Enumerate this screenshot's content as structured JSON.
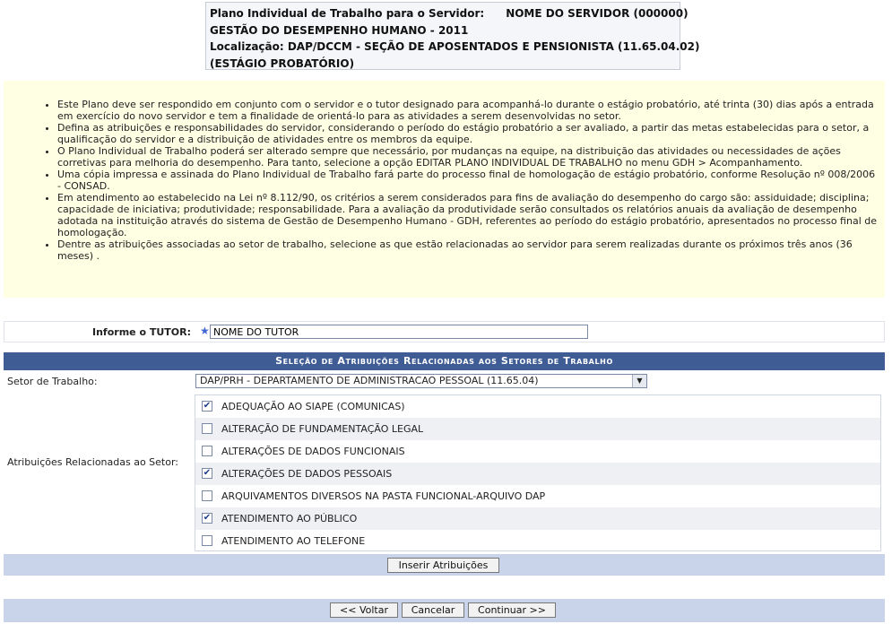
{
  "header": {
    "plano_label": "Plano Individual de Trabalho para o Servidor:",
    "servidor": "NOME DO SERVIDOR (000000)",
    "line2": "GESTÃO DO DESEMPENHO HUMANO - 2011",
    "line3": "Localização: DAP/DCCM - SEÇÃO DE APOSENTADOS E PENSIONISTA (11.65.04.02)",
    "line4": "(ESTÁGIO PROBATÓRIO)"
  },
  "info": {
    "items": [
      "Este Plano deve ser respondido em conjunto com o servidor e o tutor designado para acompanhá-lo durante o estágio probatório, até trinta (30) dias após a entrada em exercício do novo servidor e tem a finalidade de orientá-lo para as atividades a serem desenvolvidas no setor.",
      "Defina as atribuições e responsabilidades do servidor, considerando o período do estágio probatório a ser avaliado, a partir das metas estabelecidas para o setor, a qualificação do servidor e a distribuição de atividades entre os membros da equipe.",
      "O Plano Individual de Trabalho poderá ser alterado sempre que necessário, por mudanças na equipe, na distribuição das atividades ou necessidades de ações corretivas para melhoria do desempenho. Para tanto, selecione a opção EDITAR PLANO INDIVIDUAL DE TRABALHO no menu GDH > Acompanhamento.",
      "Uma cópia impressa e assinada do Plano Individual de Trabalho fará parte do processo final de homologação de estágio probatório, conforme Resolução nº 008/2006 - CONSAD.",
      "Em atendimento ao estabelecido na Lei nº 8.112/90, os critérios a serem considerados para fins de avaliação do desempenho do cargo são: assiduidade; disciplina; capacidade de iniciativa; produtividade; responsabilidade. Para a avaliação da produtividade serão consultados os relatórios anuais da avaliação de desempenho adotada na instituição através do sistema de Gestão de Desempenho Humano - GDH, referentes ao período do estágio probatório, apresentados no processo final de homologação.",
      "Dentre as atribuições associadas ao setor de trabalho, selecione as que estão relacionadas ao servidor para serem realizadas durante os próximos três anos (36 meses) ."
    ]
  },
  "tutor": {
    "label": "Informe o TUTOR:",
    "required_mark": "★",
    "value": "NOME DO TUTOR"
  },
  "selection": {
    "title": "Seleção de Atribuições Relacionadas aos Setores de Trabalho",
    "setor_label": "Setor de Trabalho:",
    "setor_value": "DAP/PRH - DEPARTAMENTO DE ADMINISTRACAO PESSOAL (11.65.04)",
    "atrib_label": "Atribuições Relacionadas ao Setor:",
    "attributes": [
      {
        "label": "ADEQUAÇÃO AO SIAPE (COMUNICAS)",
        "checked": true
      },
      {
        "label": "ALTERAÇÃO DE FUNDAMENTAÇÃO LEGAL",
        "checked": false
      },
      {
        "label": "ALTERAÇÕES DE DADOS FUNCIONAIS",
        "checked": false
      },
      {
        "label": "ALTERAÇÕES DE DADOS PESSOAIS",
        "checked": true
      },
      {
        "label": "ARQUIVAMENTOS DIVERSOS NA PASTA FUNCIONAL-ARQUIVO DAP",
        "checked": false
      },
      {
        "label": "ATENDIMENTO AO PÚBLICO",
        "checked": true
      },
      {
        "label": "ATENDIMENTO AO TELEFONE",
        "checked": false
      }
    ],
    "insert_button": "Inserir Atribuições"
  },
  "footer": {
    "voltar": "<< Voltar",
    "cancelar": "Cancelar",
    "continuar": "Continuar >>"
  },
  "colors": {
    "header_bar": "#3f5c94",
    "info_bg": "#ffffe4",
    "button_bar": "#c9d3ea"
  }
}
